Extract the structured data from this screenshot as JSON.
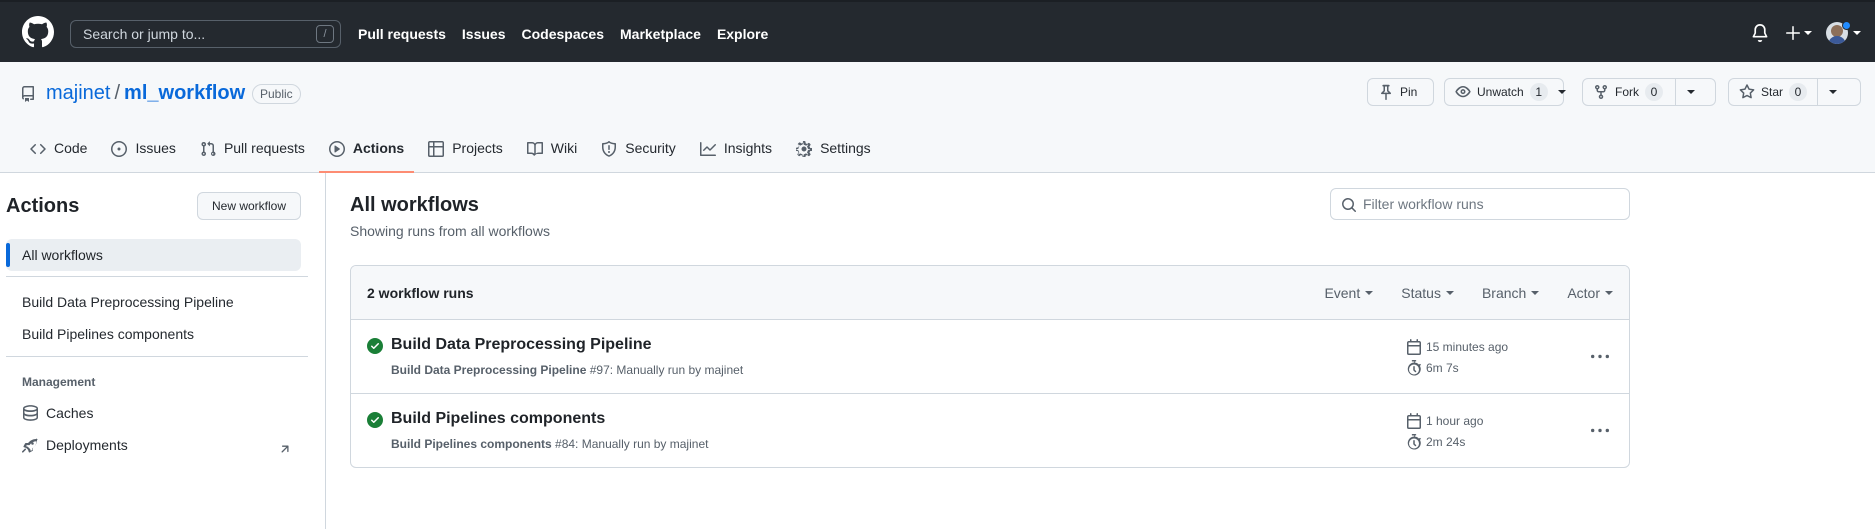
{
  "header": {
    "search_placeholder": "Search or jump to...",
    "search_shortcut": "/",
    "nav": [
      "Pull requests",
      "Issues",
      "Codespaces",
      "Marketplace",
      "Explore"
    ]
  },
  "repo": {
    "owner": "majinet",
    "separator": "/",
    "name": "ml_workflow",
    "visibility": "Public",
    "pin_label": "Pin",
    "unwatch_label": "Unwatch",
    "watch_count": "1",
    "fork_label": "Fork",
    "fork_count": "0",
    "star_label": "Star",
    "star_count": "0",
    "tabs": [
      {
        "label": "Code",
        "icon": "code-icon"
      },
      {
        "label": "Issues",
        "icon": "issue-opened-icon"
      },
      {
        "label": "Pull requests",
        "icon": "git-pull-request-icon"
      },
      {
        "label": "Actions",
        "icon": "play-icon",
        "active": true
      },
      {
        "label": "Projects",
        "icon": "table-icon"
      },
      {
        "label": "Wiki",
        "icon": "book-icon"
      },
      {
        "label": "Security",
        "icon": "shield-icon"
      },
      {
        "label": "Insights",
        "icon": "graph-icon"
      },
      {
        "label": "Settings",
        "icon": "gear-icon"
      }
    ]
  },
  "sidebar": {
    "title": "Actions",
    "new_workflow_label": "New workflow",
    "all_workflows": "All workflows",
    "workflows": [
      "Build Data Preprocessing Pipeline",
      "Build Pipelines components"
    ],
    "management_heading": "Management",
    "management_items": [
      {
        "label": "Caches",
        "icon": "database-icon"
      },
      {
        "label": "Deployments",
        "icon": "rocket-icon"
      }
    ]
  },
  "main": {
    "title": "All workflows",
    "subtitle": "Showing runs from all workflows",
    "filter_placeholder": "Filter workflow runs",
    "runs_count": "2 workflow runs",
    "filters": [
      "Event",
      "Status",
      "Branch",
      "Actor"
    ],
    "runs": [
      {
        "title": "Build Data Preprocessing Pipeline",
        "workflow": "Build Data Preprocessing Pipeline",
        "detail": "#97: Manually run by majinet",
        "time": "15 minutes ago",
        "duration": "6m 7s",
        "status": "success"
      },
      {
        "title": "Build Pipelines components",
        "workflow": "Build Pipelines components",
        "detail": "#84: Manually run by majinet",
        "time": "1 hour ago",
        "duration": "2m 24s",
        "status": "success"
      }
    ]
  },
  "colors": {
    "header_bg": "#24292f",
    "link": "#0969da",
    "success": "#1a7f37",
    "active_tab_underline": "#fd8c73"
  }
}
